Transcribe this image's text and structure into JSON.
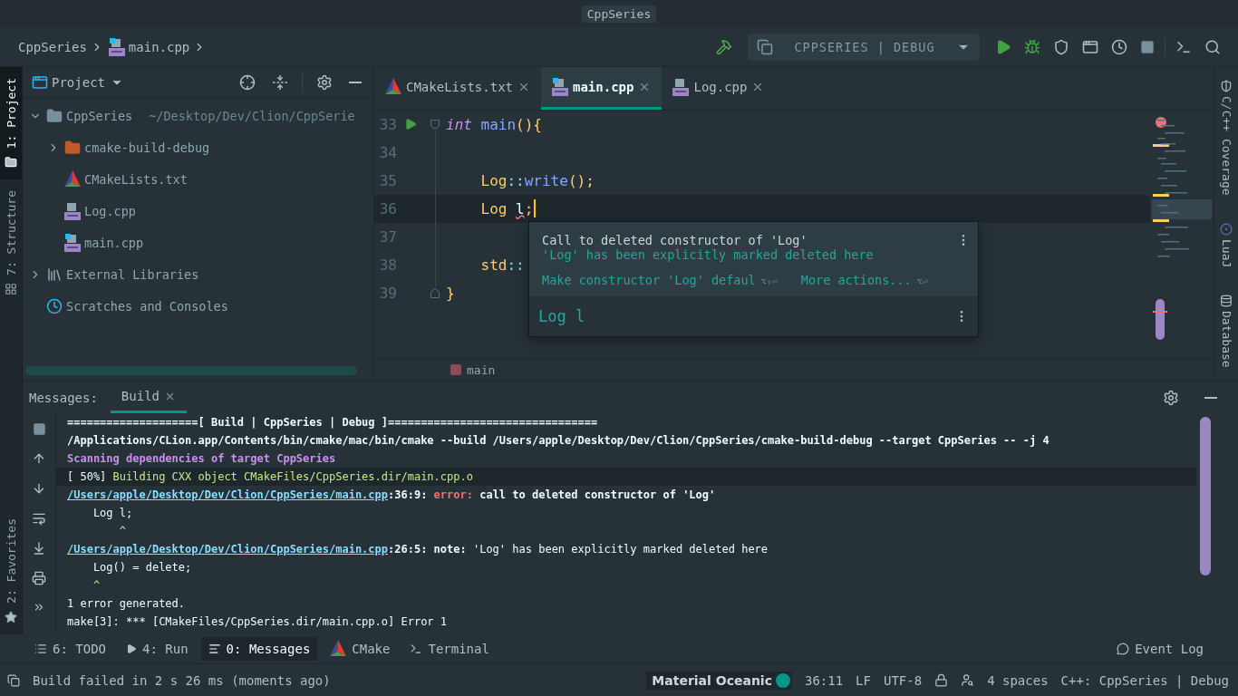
{
  "window": {
    "title": "CppSeries"
  },
  "breadcrumbs": [
    {
      "label": "CppSeries",
      "kind": "project"
    },
    {
      "label": "main.cpp",
      "kind": "cpp"
    }
  ],
  "run_config": {
    "label": "CPPSERIES | DEBUG"
  },
  "left_tool_tabs": [
    {
      "label": "1: Project",
      "kind": "project",
      "selected": true
    },
    {
      "label": "7: Structure",
      "kind": "structure",
      "selected": false
    },
    {
      "label": "2: Favorites",
      "kind": "favorites",
      "selected": false
    }
  ],
  "project_panel": {
    "title": "Project",
    "tree": [
      {
        "label": "CppSeries",
        "kind": "folder",
        "path": "~/Desktop/Dev/Clion/CppSerie",
        "expanded": true,
        "children": [
          {
            "label": "cmake-build-debug",
            "kind": "build-folder",
            "expanded": false
          },
          {
            "label": "CMakeLists.txt",
            "kind": "cmake"
          },
          {
            "label": "Log.cpp",
            "kind": "cpp"
          },
          {
            "label": "main.cpp",
            "kind": "cpp-main"
          }
        ]
      },
      {
        "label": "External Libraries",
        "kind": "libraries",
        "expanded": false
      },
      {
        "label": "Scratches and Consoles",
        "kind": "scratches"
      }
    ]
  },
  "editor": {
    "tabs": [
      {
        "label": "CMakeLists.txt",
        "kind": "cmake",
        "selected": false
      },
      {
        "label": "main.cpp",
        "kind": "cpp-main",
        "selected": true
      },
      {
        "label": "Log.cpp",
        "kind": "cpp",
        "selected": false
      }
    ],
    "lines": [
      {
        "number": "33",
        "runnable": true,
        "fold_start": true,
        "current": false,
        "tokens": [
          {
            "text": "int",
            "kind": "keyword"
          },
          {
            "text": " main",
            "kind": "function"
          },
          {
            "text": "(){",
            "kind": "punct"
          }
        ]
      },
      {
        "number": "34",
        "current": false
      },
      {
        "number": "35",
        "current": false,
        "tokens": [
          {
            "text": "    Log",
            "kind": "type"
          },
          {
            "text": "::",
            "kind": "scope"
          },
          {
            "text": "write",
            "kind": "function"
          },
          {
            "text": "();",
            "kind": "punct"
          }
        ]
      },
      {
        "number": "36",
        "current": true,
        "tokens": [
          {
            "text": "    Log ",
            "kind": "type"
          },
          {
            "text": "l",
            "kind": "error"
          },
          {
            "text": ";",
            "kind": "punct"
          }
        ]
      },
      {
        "number": "37",
        "current": false
      },
      {
        "number": "38",
        "current": false,
        "tokens": [
          {
            "text": "    std",
            "kind": "type"
          },
          {
            "text": "::",
            "kind": "scope"
          }
        ]
      },
      {
        "number": "39",
        "fold_end": true,
        "current": false,
        "tokens": [
          {
            "text": "}",
            "kind": "punct"
          }
        ]
      }
    ],
    "popup": {
      "message": "Call to deleted constructor of 'Log'",
      "detail": "'Log' has been explicitly marked deleted here",
      "actions": [
        {
          "label": "Make constructor 'Log' defaul",
          "shortcut": "⌥⇧⏎"
        },
        {
          "label": "More actions...",
          "shortcut": "⌥⏎"
        }
      ],
      "declaration": "Log l"
    },
    "footer": "main"
  },
  "right_tool_tabs": [
    {
      "label": "C/C++ Coverage",
      "kind": "coverage"
    },
    {
      "label": "LuaJ",
      "kind": "lua"
    },
    {
      "label": "Database",
      "kind": "database"
    }
  ],
  "messages": {
    "title": "Messages:",
    "tabs": [
      {
        "label": "Build",
        "selected": true
      }
    ],
    "output": [
      {
        "selected": false,
        "segments": [
          {
            "text": "====================[ Build | CppSeries | Debug ]================================",
            "kind": "bold"
          }
        ]
      },
      {
        "selected": false,
        "segments": [
          {
            "text": "/Applications/CLion.app/Contents/bin/cmake/mac/bin/cmake --build /Users/apple/Desktop/Dev/Clion/CppSeries/cmake-build-debug --target CppSeries -- -j 4",
            "kind": "bold"
          }
        ]
      },
      {
        "selected": false,
        "segments": [
          {
            "text": "Scanning dependencies of target CppSeries",
            "kind": "purple"
          }
        ]
      },
      {
        "selected": true,
        "segments": [
          {
            "text": "[ 50%] ",
            "kind": "plain"
          },
          {
            "text": "Building CXX object CMakeFiles/CppSeries.dir/main.cpp.o",
            "kind": "green"
          }
        ]
      },
      {
        "selected": false,
        "segments": [
          {
            "text": "/Users/apple/Desktop/Dev/Clion/CppSeries/main.cpp",
            "kind": "link"
          },
          {
            "text": ":36:9: ",
            "kind": "bold"
          },
          {
            "text": "error:",
            "kind": "error"
          },
          {
            "text": " call to deleted constructor of 'Log'",
            "kind": "bold"
          }
        ]
      },
      {
        "selected": false,
        "segments": [
          {
            "text": "    Log l;",
            "kind": "plain"
          }
        ]
      },
      {
        "selected": false,
        "segments": [
          {
            "text": "        ^",
            "kind": "green"
          }
        ]
      },
      {
        "selected": false,
        "segments": [
          {
            "text": "/Users/apple/Desktop/Dev/Clion/CppSeries/main.cpp",
            "kind": "link"
          },
          {
            "text": ":26:5: ",
            "kind": "bold"
          },
          {
            "text": "note:",
            "kind": "bold"
          },
          {
            "text": " 'Log' has been explicitly marked deleted here",
            "kind": "plain"
          }
        ]
      },
      {
        "selected": false,
        "segments": [
          {
            "text": "    Log() = delete;",
            "kind": "plain"
          }
        ]
      },
      {
        "selected": false,
        "segments": [
          {
            "text": "    ^",
            "kind": "green"
          }
        ]
      },
      {
        "selected": false,
        "segments": [
          {
            "text": "1 error generated.",
            "kind": "plain"
          }
        ]
      },
      {
        "selected": false,
        "segments": [
          {
            "text": "make[3]: *** [CMakeFiles/CppSeries.dir/main.cpp.o] Error 1",
            "kind": "plain"
          }
        ]
      }
    ]
  },
  "tool_windows": [
    {
      "label": "6: TODO",
      "kind": "todo",
      "selected": false
    },
    {
      "label": "4: Run",
      "kind": "run",
      "selected": false
    },
    {
      "label": "0: Messages",
      "kind": "messages",
      "selected": true
    },
    {
      "label": "CMake",
      "kind": "cmake",
      "selected": false
    },
    {
      "label": "Terminal",
      "kind": "terminal",
      "selected": false
    }
  ],
  "event_log": "Event Log",
  "status_bar": {
    "message": "Build failed in 2 s 26 ms (moments ago)",
    "theme": {
      "label": "Material Oceanic",
      "color": "#009688"
    },
    "items": [
      {
        "kind": "text",
        "label": "36:11"
      },
      {
        "kind": "text",
        "label": "LF"
      },
      {
        "kind": "text",
        "label": "UTF-8"
      },
      {
        "kind": "lock"
      },
      {
        "kind": "inspector"
      },
      {
        "kind": "text",
        "label": "4 spaces"
      },
      {
        "kind": "text",
        "label": "C++: CppSeries | Debug"
      }
    ]
  }
}
